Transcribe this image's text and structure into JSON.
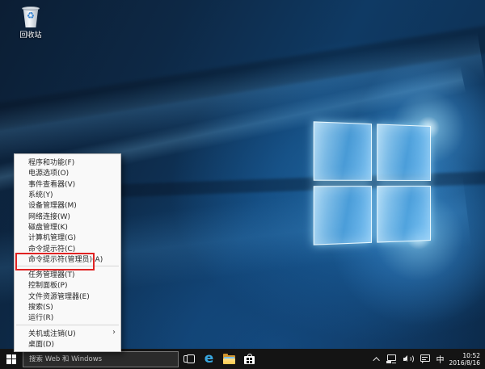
{
  "desktop": {
    "recycle_bin_label": "回收站",
    "recycle_symbol": "♻"
  },
  "context_menu": {
    "items": [
      {
        "label": "程序和功能(F)"
      },
      {
        "label": "电源选项(O)"
      },
      {
        "label": "事件查看器(V)"
      },
      {
        "label": "系统(Y)"
      },
      {
        "label": "设备管理器(M)"
      },
      {
        "label": "网络连接(W)"
      },
      {
        "label": "磁盘管理(K)"
      },
      {
        "label": "计算机管理(G)"
      },
      {
        "label": "命令提示符(C)"
      },
      {
        "label": "命令提示符(管理员)(A)",
        "highlighted": true
      },
      {
        "label": "任务管理器(T)"
      },
      {
        "label": "控制面板(P)"
      },
      {
        "label": "文件资源管理器(E)"
      },
      {
        "label": "搜索(S)"
      },
      {
        "label": "运行(R)"
      },
      {
        "label": "关机或注销(U)",
        "submenu_arrow": "›"
      },
      {
        "label": "桌面(D)"
      }
    ],
    "highlighted_item": "命令提示符(管理员)(A)"
  },
  "taskbar": {
    "search": {
      "placeholder": "搜索 Web 和 Windows"
    },
    "edge_letter": "e",
    "tray": {
      "ime_indicator": "中",
      "time": "10:52",
      "date": "2016/8/16"
    }
  },
  "colors": {
    "highlight_red": "#e02222",
    "wallpaper_blue": "#0f3a64",
    "edge_blue": "#39a7e0",
    "folder_yellow": "#fcc94f",
    "taskbar_bg": "#141414"
  }
}
